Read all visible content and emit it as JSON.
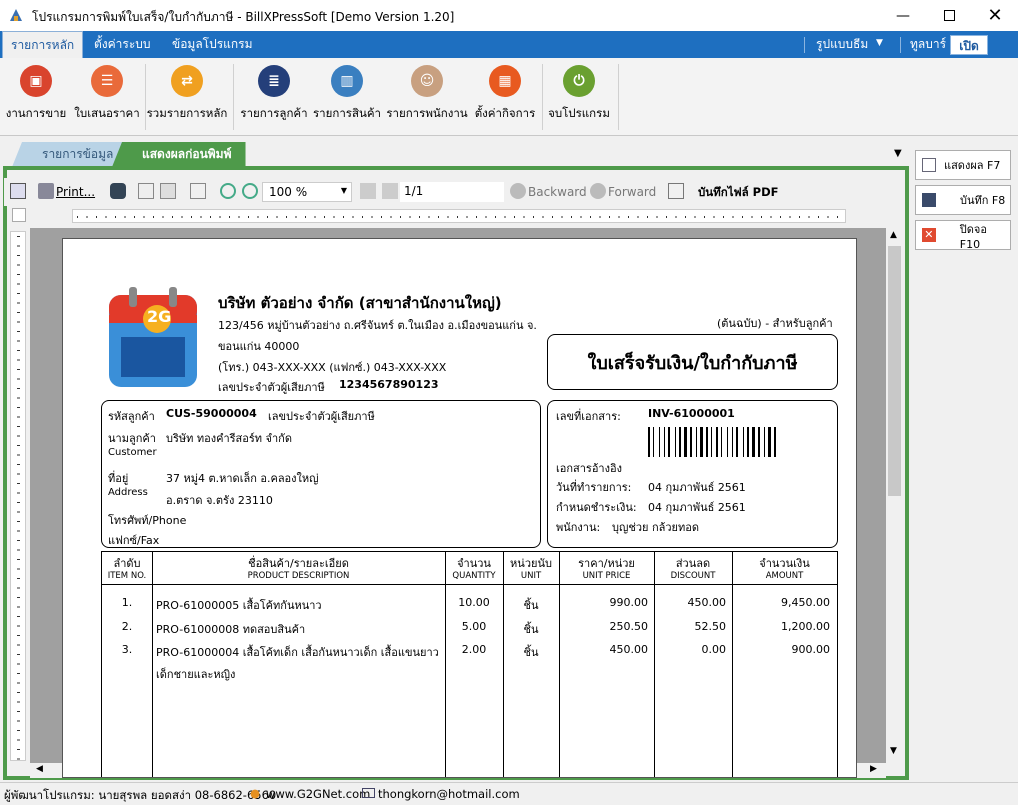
{
  "window": {
    "title": "โปรแกรมการพิมพ์ใบเสร็จ/ใบกำกับภาษี - BillXPressSoft [Demo Version 1.20]"
  },
  "menu": {
    "tabs": [
      "รายการหลัก",
      "ตั้งค่าระบบ",
      "ข้อมูลโปรแกรม"
    ],
    "right": [
      "รูปแบบธีม",
      "ทูลบาร์",
      "เปิด"
    ]
  },
  "ribbon": {
    "buttons": [
      "งานการขาย",
      "ใบเสนอราคา",
      "รวมรายการหลัก",
      "รายการลูกค้า",
      "รายการสินค้า",
      "รายการพนักงาน",
      "ตั้งค่ากิจการ",
      "จบโปรแกรม"
    ]
  },
  "doctabs": [
    "รายการข้อมูล",
    "แสดงผลก่อนพิมพ์"
  ],
  "toolbar": {
    "print": "Print...",
    "zoom": "100 %",
    "page": "1/1",
    "backward": "Backward",
    "forward": "Forward",
    "pdf": "บันทึกไฟล์ PDF"
  },
  "side": {
    "show": "แสดงผล F7",
    "save": "บันทึก F8",
    "close": "ปิดจอ F10"
  },
  "doc": {
    "logo": "2G",
    "company": "บริษัท ตัวอย่าง จำกัด (สาขาสำนักงานใหญ่)",
    "addr1": "123/456 หมู่บ้านตัวอย่าง ถ.ศรีจันทร์ ต.ในเมือง อ.เมืองขอนแก่น จ.",
    "addr2": "ขอนแก่น 40000",
    "phone": "(โทร.) 043-XXX-XXX  (แฟกซ์.) 043-XXX-XXX",
    "taxid_label": "เลขประจำตัวผู้เสียภาษี",
    "taxid": "1234567890123",
    "copy": "(ต้นฉบับ) - สำหรับลูกค้า",
    "doctitle": "ใบเสร็จรับเงิน/ใบกำกับภาษี",
    "cust_code_label": "รหัสลูกค้า",
    "cust_code": "CUS-59000004",
    "cust_tax_label": "เลขประจำตัวผู้เสียภาษี",
    "cust_name_label": "นามลูกค้า",
    "cust_name": "บริษัท ทองคำรีสอร์ท จำกัด",
    "customer_en": "Customer",
    "addr_label": "ที่อยู่",
    "address_en": "Address",
    "cust_addr1": "37 หมู่4 ต.หาดเล็ก อ.คลองใหญ่",
    "cust_addr2": "อ.ตราด จ.ตรัง 23110",
    "tel_label": "โทรศัพท์/Phone",
    "fax_label": "แฟกซ์/Fax",
    "docno_label": "เลขที่เอกสาร:",
    "docno": "INV-61000001",
    "ref_label": "เอกสารอ้างอิง",
    "date_label": "วันที่ทำรายการ:",
    "date": "04 กุมภาพันธ์ 2561",
    "due_label": "กำหนดชำระเงิน:",
    "due": "04 กุมภาพันธ์ 2561",
    "staff_label": "พนักงาน:",
    "staff": "บุญช่วย กล้วยทอด"
  },
  "table": {
    "headers": [
      {
        "th": "ลำดับ",
        "en": "ITEM NO."
      },
      {
        "th": "ชื่อสินค้า/รายละเอียด",
        "en": "PRODUCT DESCRIPTION"
      },
      {
        "th": "จำนวน",
        "en": "QUANTITY"
      },
      {
        "th": "หน่วยนับ",
        "en": "UNIT"
      },
      {
        "th": "ราคา/หน่วย",
        "en": "UNIT PRICE"
      },
      {
        "th": "ส่วนลด",
        "en": "DISCOUNT"
      },
      {
        "th": "จำนวนเงิน",
        "en": "AMOUNT"
      }
    ],
    "rows": [
      {
        "no": "1.",
        "desc": "PRO-61000005 เสื้อโค้ทกันหนาว",
        "desc2": "",
        "qty": "10.00",
        "unit": "ชิ้น",
        "price": "990.00",
        "disc": "450.00",
        "amount": "9,450.00"
      },
      {
        "no": "2.",
        "desc": "PRO-61000008 ทดสอบสินค้า",
        "desc2": "",
        "qty": "5.00",
        "unit": "ชิ้น",
        "price": "250.50",
        "disc": "52.50",
        "amount": "1,200.00"
      },
      {
        "no": "3.",
        "desc": "PRO-61000004 เสื้อโค้ทเด็ก เสื้อกันหนาวเด็ก เสื้อแขนยาว",
        "desc2": "เด็กชายและหญิง",
        "qty": "2.00",
        "unit": "ชิ้น",
        "price": "450.00",
        "disc": "0.00",
        "amount": "900.00"
      }
    ]
  },
  "status": {
    "dev": "ผู้พัฒนาโปรแกรม: นายสุรพล ยอดสง่า 08-6862-6560",
    "web": "www.G2GNet.com",
    "email": "thongkorn@hotmail.com"
  }
}
